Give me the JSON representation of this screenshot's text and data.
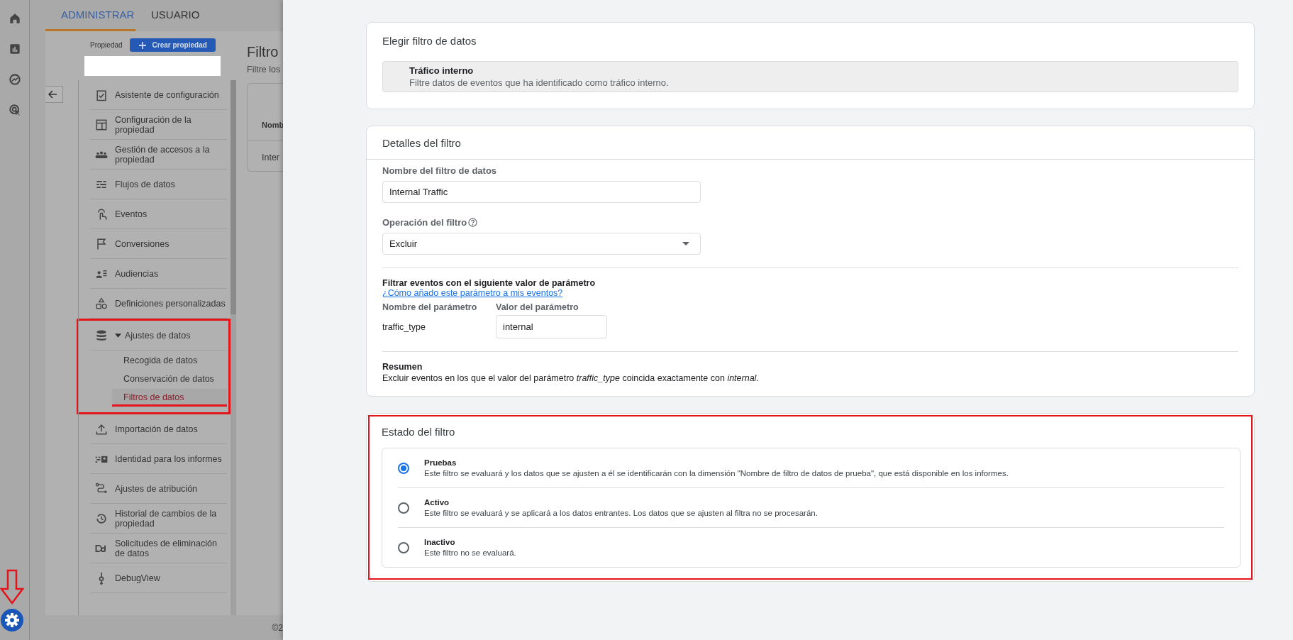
{
  "tabs": [
    {
      "label": "ADMINISTRAR",
      "selected": true
    },
    {
      "label": "USUARIO",
      "selected": false
    }
  ],
  "property": {
    "label": "Propiedad",
    "create_button": "Crear propiedad"
  },
  "nav": [
    {
      "label": "Asistente de configuración",
      "kind": "link"
    },
    {
      "label": "Configuración de la propiedad",
      "kind": "link"
    },
    {
      "label": "Gestión de accesos a la propiedad",
      "kind": "link"
    },
    {
      "label": "Flujos de datos",
      "kind": "link"
    },
    {
      "label": "Eventos",
      "kind": "link"
    },
    {
      "label": "Conversiones",
      "kind": "link"
    },
    {
      "label": "Audiencias",
      "kind": "link"
    },
    {
      "label": "Definiciones personalizadas",
      "kind": "link"
    },
    {
      "label": "Ajustes de datos",
      "kind": "group",
      "expanded": true,
      "children": [
        {
          "label": "Recogida de datos",
          "selected": false
        },
        {
          "label": "Conservación de datos",
          "selected": false
        },
        {
          "label": "Filtros de datos",
          "selected": true
        }
      ]
    },
    {
      "label": "Importación de datos",
      "kind": "link"
    },
    {
      "label": "Identidad para los informes",
      "kind": "link"
    },
    {
      "label": "Ajustes de atribución",
      "kind": "link"
    },
    {
      "label": "Historial de cambios de la propiedad",
      "kind": "link"
    },
    {
      "label": "Solicitudes de eliminación de datos",
      "kind": "link"
    },
    {
      "label": "DebugView",
      "kind": "link"
    }
  ],
  "background_page": {
    "title": "Filtro",
    "subtitle": "Filtre los",
    "column_1": "Nomb",
    "row_1": "Inter",
    "footer": "©2"
  },
  "choose_filter": {
    "title": "Elegir filtro de datos",
    "option": {
      "name": "Tráfico interno",
      "description": "Filtre datos de eventos que ha identificado como tráfico interno."
    }
  },
  "details": {
    "title": "Detalles del filtro",
    "name_label": "Nombre del filtro de datos",
    "name_value": "Internal Traffic",
    "operation_label": "Operación del filtro",
    "operation_value": "Excluir",
    "section_title": "Filtrar eventos con el siguiente valor de parámetro",
    "help_link": "¿Cómo añado este parámetro a mis eventos?",
    "param_name_label": "Nombre del parámetro",
    "param_value_label": "Valor del parámetro",
    "param_name": "traffic_type",
    "param_value": "internal",
    "summary_title": "Resumen",
    "summary": "Excluir eventos en los que el valor del parámetro *traffic_type* coincida exactamente con *internal*."
  },
  "status": {
    "title": "Estado del filtro",
    "options": [
      {
        "name": "Pruebas",
        "description": "Este filtro se evaluará y los datos que se ajusten a él se identificarán con la dimensión \"Nombre de filtro de datos de prueba\", que está disponible en los informes.",
        "selected": true
      },
      {
        "name": "Activo",
        "description": "Este filtro se evaluará y se aplicará a los datos entrantes. Los datos que se ajusten al filtra no se procesarán.",
        "selected": false
      },
      {
        "name": "Inactivo",
        "description": "Este filtro no se evaluará.",
        "selected": false
      }
    ]
  }
}
